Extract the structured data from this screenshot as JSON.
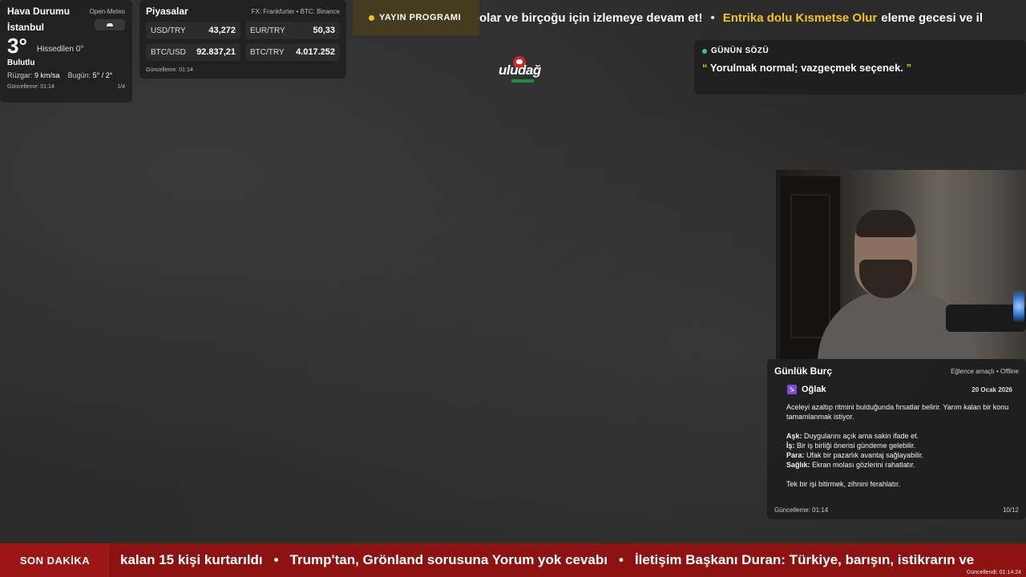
{
  "weather": {
    "title": "Hava Durumu",
    "source": "Open-Meteo",
    "city": "İstanbul",
    "icon": "cloud-icon",
    "temp": "3°",
    "feels_like": "Hissedilen 0°",
    "condition": "Bulutlu",
    "wind_label": "Rüzgar:",
    "wind_value": "9 km/sa",
    "today_label": "Bugün:",
    "today_value": "5° / 2°",
    "updated": "Güncelleme: 01:14",
    "page": "1/4"
  },
  "markets": {
    "title": "Piyasalar",
    "source": "FX: Frankfurter • BTC: Binance",
    "items": [
      {
        "label": "USD/TRY",
        "value": "43,272"
      },
      {
        "label": "EUR/TRY",
        "value": "50,33"
      },
      {
        "label": "BTC/USD",
        "value": "92.837,21"
      },
      {
        "label": "BTC/TRY",
        "value": "4.017.252"
      }
    ],
    "updated": "Güncelleme: 01:14"
  },
  "top_ticker": {
    "label": "YAYIN PROGRAMI",
    "text_1": "olar ve birçoğu için izlemeye devam et!",
    "separator": "•",
    "highlight": "Entrika dolu Kısmetse Olur",
    "text_2": "eleme gecesi ve il"
  },
  "logo": {
    "text": "uludağ"
  },
  "quote": {
    "label": "GÜNÜN SÖZÜ",
    "open_mark": "“",
    "text": "Yorulmak normal; vazgeçmek seçenek.",
    "close_mark": "”"
  },
  "horoscope": {
    "title": "Günlük Burç",
    "tag": "Eğlence amaçlı • Offline",
    "symbol": "♑",
    "sign": "Oğlak",
    "date": "20 Ocak 2026",
    "intro": "Aceleyi azaltıp ritmini bulduğunda fırsatlar belirir. Yarım kalan bir konu tamamlanmak istiyor.",
    "love_label": "Aşk:",
    "love": "Duygularını açık ama sakin ifade et.",
    "work_label": "İş:",
    "work": "Bir iş birliği önerisi gündeme gelebilir.",
    "money_label": "Para:",
    "money": "Ufak bir pazarlık avantaj sağlayabilir.",
    "health_label": "Sağlık:",
    "health": "Ekran molası gözlerini rahatlatır.",
    "tip": "Tek bir işi bitirmek, zihnini ferahlatır.",
    "updated": "Güncelleme: 01:14",
    "page": "10/12"
  },
  "breaking": {
    "label": "SON DAKİKA",
    "items": [
      "kalan 15 kişi kurtarıldı",
      "Trump'tan, Grönland sorusuna Yorum yok cevabı",
      "İletişim Başkanı Duran: Türkiye, barışın, istikrarın ve"
    ],
    "separator": "•",
    "updated": "Güncellendi: 01:14:24"
  },
  "colors": {
    "accent_yellow": "#f0c419",
    "breaking_red": "#8d1212",
    "quote_green": "#46c35a",
    "sign_purple": "#7c4fd6"
  }
}
